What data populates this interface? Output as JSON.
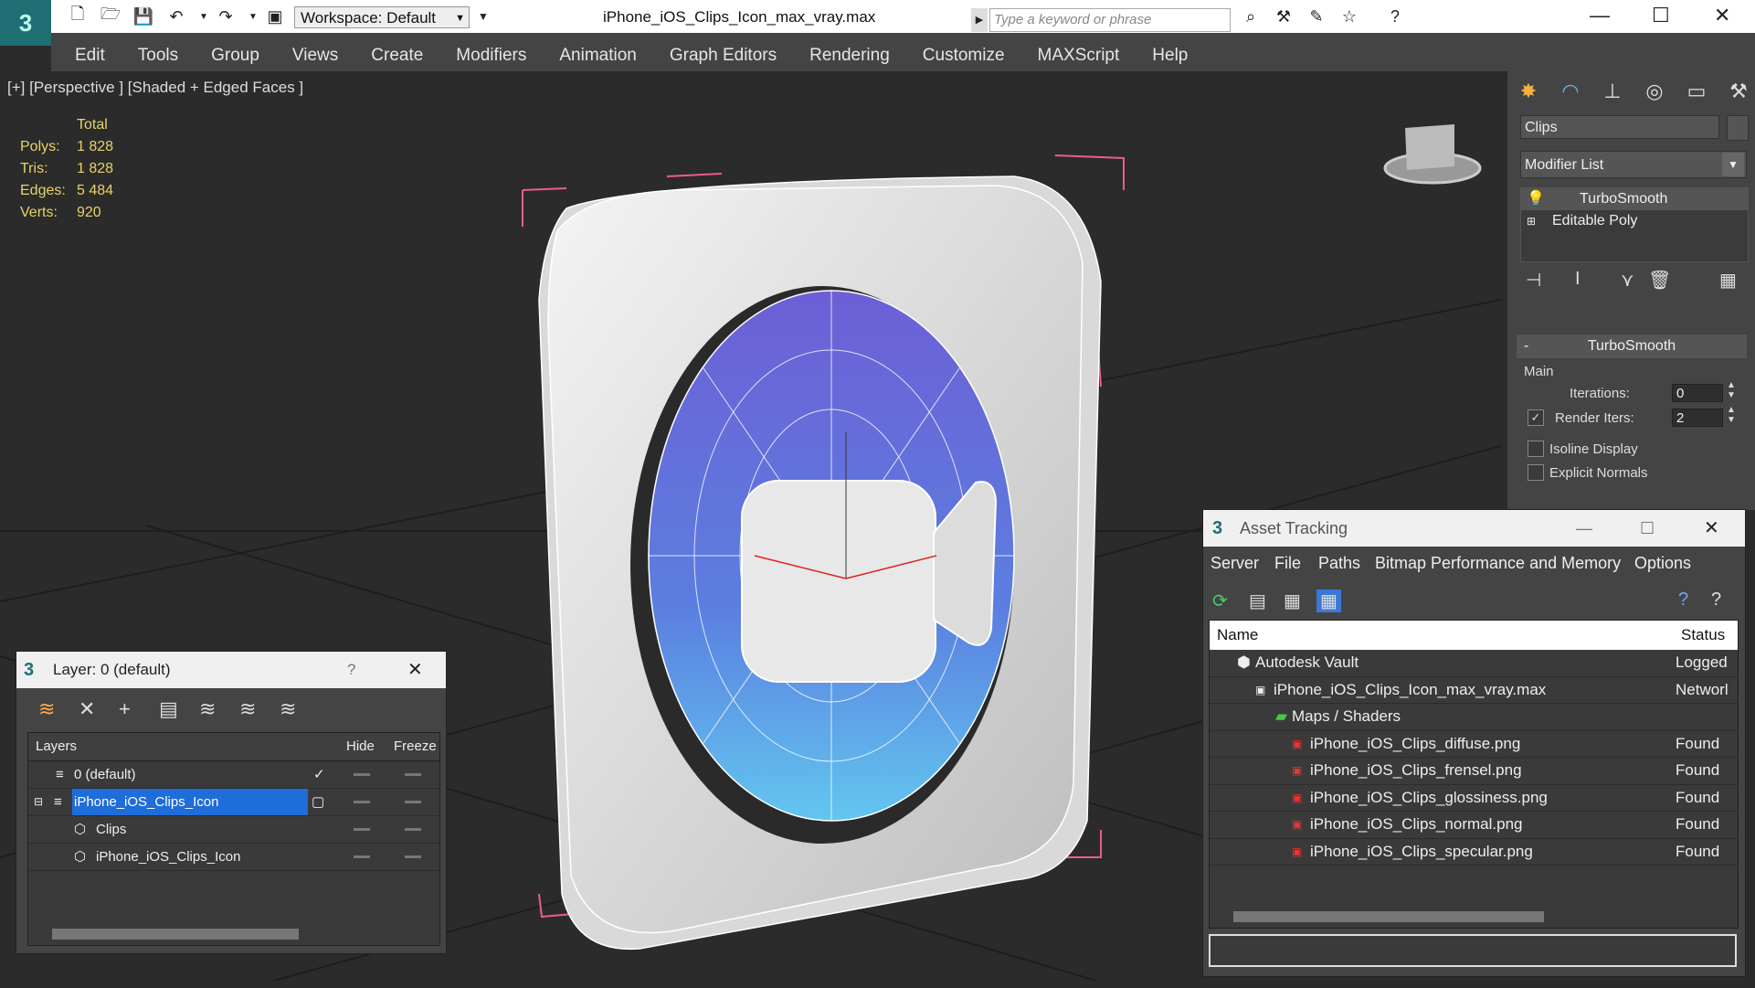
{
  "app": {
    "title": "iPhone_iOS_Clips_Icon_max_vray.max",
    "workspace": "Workspace: Default",
    "search_placeholder": "Type a keyword or phrase"
  },
  "menu": [
    "Edit",
    "Tools",
    "Group",
    "Views",
    "Create",
    "Modifiers",
    "Animation",
    "Graph Editors",
    "Rendering",
    "Customize",
    "MAXScript",
    "Help"
  ],
  "viewport": {
    "label": "[+] [Perspective ] [Shaded + Edged Faces ]",
    "stats": {
      "header": "Total",
      "rows": [
        {
          "label": "Polys:",
          "value": "1 828"
        },
        {
          "label": "Tris:",
          "value": "1 828"
        },
        {
          "label": "Edges:",
          "value": "5 484"
        },
        {
          "label": "Verts:",
          "value": "920"
        }
      ]
    }
  },
  "command_panel": {
    "object_name": "Clips",
    "modifier_list": "Modifier List",
    "stack": [
      "TurboSmooth",
      "Editable Poly"
    ],
    "rollout": "TurboSmooth",
    "group": "Main",
    "iterations_label": "Iterations:",
    "iterations": "0",
    "render_iters_label": "Render Iters:",
    "render_iters": "2",
    "isoline": "Isoline Display",
    "explicit": "Explicit Normals"
  },
  "layer_dialog": {
    "title": "Layer: 0 (default)",
    "help": "?",
    "columns": {
      "layers": "Layers",
      "hide": "Hide",
      "freeze": "Freeze"
    },
    "rows": [
      {
        "name": "0 (default)"
      },
      {
        "name": "iPhone_iOS_Clips_Icon"
      },
      {
        "name": "Clips"
      },
      {
        "name": "iPhone_iOS_Clips_Icon"
      }
    ]
  },
  "asset_dialog": {
    "title": "Asset Tracking",
    "menu": [
      "Server",
      "File",
      "Paths",
      "Bitmap Performance and Memory",
      "Options"
    ],
    "columns": {
      "name": "Name",
      "status": "Status"
    },
    "rows": [
      {
        "name": "Autodesk Vault",
        "status": "Logged"
      },
      {
        "name": "iPhone_iOS_Clips_Icon_max_vray.max",
        "status": "Networl"
      },
      {
        "name": "Maps / Shaders",
        "status": ""
      },
      {
        "name": "iPhone_iOS_Clips_diffuse.png",
        "status": "Found"
      },
      {
        "name": "iPhone_iOS_Clips_frensel.png",
        "status": "Found"
      },
      {
        "name": "iPhone_iOS_Clips_glossiness.png",
        "status": "Found"
      },
      {
        "name": "iPhone_iOS_Clips_normal.png",
        "status": "Found"
      },
      {
        "name": "iPhone_iOS_Clips_specular.png",
        "status": "Found"
      }
    ]
  }
}
